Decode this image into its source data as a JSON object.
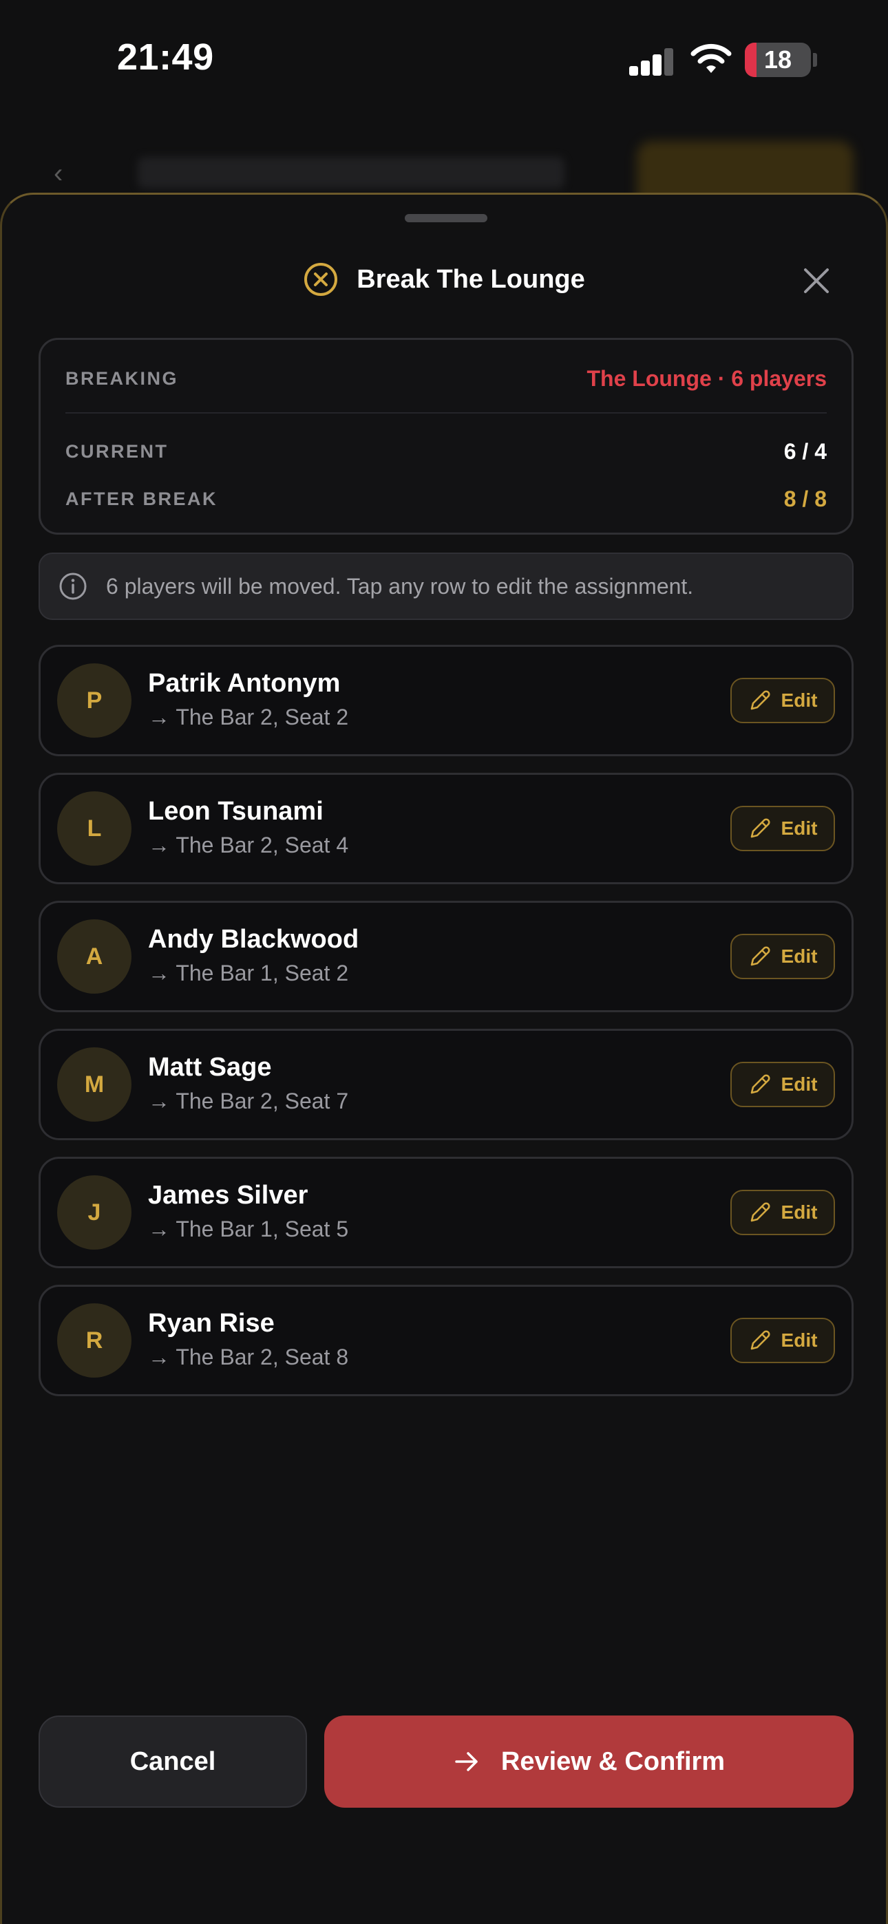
{
  "status_bar": {
    "time": "21:49",
    "battery": "18",
    "battery_fraction": 0.18
  },
  "sheet": {
    "title": "Break The Lounge",
    "summary": {
      "breaking_label": "BREAKING",
      "breaking_value": "The Lounge · 6 players",
      "current_label": "CURRENT",
      "current_value": "6 / 4",
      "after_label": "AFTER BREAK",
      "after_value": "8 / 8"
    },
    "info": "6 players will be moved. Tap any row to edit the assignment.",
    "players": [
      {
        "initial": "P",
        "name": "Patrik Antonym",
        "seat": "The Bar 2, Seat 2"
      },
      {
        "initial": "L",
        "name": "Leon Tsunami",
        "seat": "The Bar 2, Seat 4"
      },
      {
        "initial": "A",
        "name": "Andy Blackwood",
        "seat": "The Bar 1, Seat 2"
      },
      {
        "initial": "M",
        "name": "Matt Sage",
        "seat": "The Bar 2, Seat 7"
      },
      {
        "initial": "J",
        "name": "James Silver",
        "seat": "The Bar 1, Seat 5"
      },
      {
        "initial": "R",
        "name": "Ryan Rise",
        "seat": "The Bar 2, Seat 8"
      }
    ],
    "edit_label": "Edit",
    "seat_arrow": "→",
    "cancel_label": "Cancel",
    "confirm_label": "Review & Confirm"
  },
  "colors": {
    "accent_gold": "#d4a940",
    "danger_red": "#e0414a",
    "confirm_red": "#b13a3c",
    "muted": "#8e8e93"
  }
}
